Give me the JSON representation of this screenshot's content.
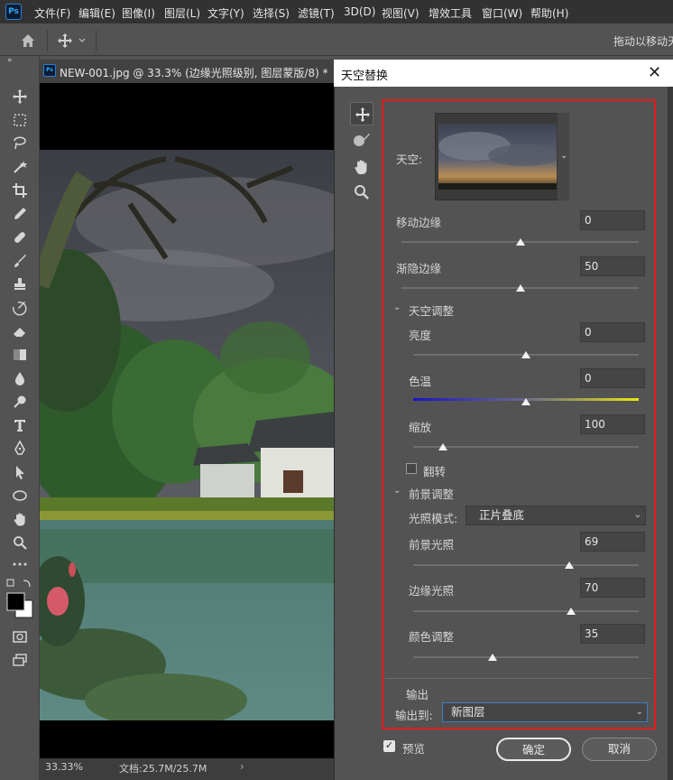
{
  "app": {
    "logo": "Ps"
  },
  "menu": [
    "文件(F)",
    "编辑(E)",
    "图像(I)",
    "图层(L)",
    "文字(Y)",
    "选择(S)",
    "滤镜(T)",
    "3D(D)",
    "视图(V)",
    "增效工具",
    "窗口(W)",
    "帮助(H)"
  ],
  "options_bar": {
    "hint": "拖动以移动天"
  },
  "document": {
    "tab_title": "NEW-001.jpg @ 33.3% (边缘光照级别, 图层蒙版/8) *",
    "zoom": "33.33%",
    "doc_size": "文档:25.7M/25.7M"
  },
  "dialog": {
    "title": "天空替换",
    "sky_label": "天空:",
    "shift_edge": {
      "label": "移动边缘",
      "value": "0",
      "slider": 0.5
    },
    "fade_edge": {
      "label": "渐隐边缘",
      "value": "50",
      "slider": 0.5
    },
    "sky_adjust": {
      "header": "天空调整",
      "brightness": {
        "label": "亮度",
        "value": "0",
        "slider": 0.5
      },
      "temperature": {
        "label": "色温",
        "value": "0",
        "slider": 0.5
      },
      "scale": {
        "label": "缩放",
        "value": "100",
        "slider": 0.13
      },
      "flip_label": "翻转",
      "flip_checked": false
    },
    "fg_adjust": {
      "header": "前景调整",
      "lighting_mode_label": "光照模式:",
      "lighting_mode_value": "正片叠底",
      "fg_lighting": {
        "label": "前景光照",
        "value": "69",
        "slider": 0.69
      },
      "edge_lighting": {
        "label": "边缘光照",
        "value": "70",
        "slider": 0.7
      },
      "color_adjust": {
        "label": "颜色调整",
        "value": "35",
        "slider": 0.35
      }
    },
    "output": {
      "header": "输出",
      "to_label": "输出到:",
      "to_value": "新图层"
    },
    "preview_label": "预览",
    "preview_checked": true,
    "ok_label": "确定",
    "cancel_label": "取消"
  },
  "colors": {
    "highlight_box": "#e11b1b",
    "temp_start": "#1b12c8",
    "temp_end": "#e8e80c"
  }
}
